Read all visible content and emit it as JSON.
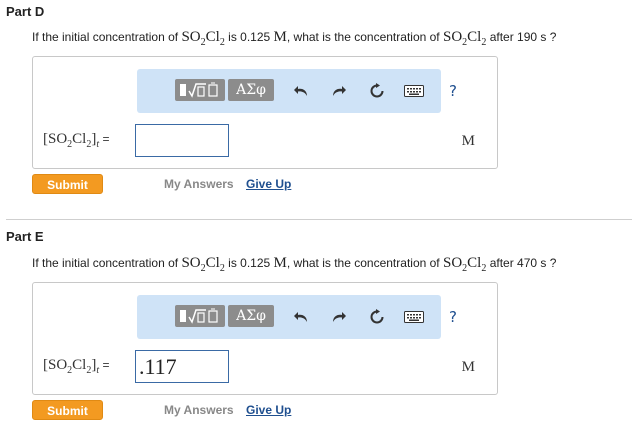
{
  "part_d": {
    "title": "Part D",
    "question_prefix": "If the initial concentration of",
    "compound_a": "SO",
    "compound_a_sub": "2",
    "compound_b": "Cl",
    "compound_b_sub": "2",
    "question_mid": "is 0.125",
    "unit_m": "M",
    "question_mid2": ", what is the concentration of",
    "question_suffix": "after 190 s ?",
    "lhs_prefix": "[SO",
    "lhs_sub1": "2",
    "lhs_cl": "Cl",
    "lhs_sub2": "2",
    "lhs_close": "]",
    "lhs_t": "t",
    "lhs_eq": " =",
    "answer_value": "",
    "unit": "M",
    "submit_label": "Submit",
    "my_answers_label": "My Answers",
    "give_up_label": "Give Up"
  },
  "part_e": {
    "title": "Part E",
    "question_prefix": "If the initial concentration of",
    "compound_a": "SO",
    "compound_a_sub": "2",
    "compound_b": "Cl",
    "compound_b_sub": "2",
    "question_mid": "is 0.125",
    "unit_m": "M",
    "question_mid2": ", what is the concentration of",
    "question_suffix": "after 470 s ?",
    "lhs_prefix": "[SO",
    "lhs_sub1": "2",
    "lhs_cl": "Cl",
    "lhs_sub2": "2",
    "lhs_close": "]",
    "lhs_t": "t",
    "lhs_eq": " =",
    "answer_value": ".117",
    "unit": "M",
    "submit_label": "Submit",
    "my_answers_label": "My Answers",
    "give_up_label": "Give Up"
  },
  "toolbar": {
    "greek_label": "ΑΣφ",
    "help_label": "?",
    "icons": [
      "template-icon",
      "undo-icon",
      "redo-icon",
      "reset-icon",
      "keyboard-icon",
      "help-icon"
    ]
  }
}
